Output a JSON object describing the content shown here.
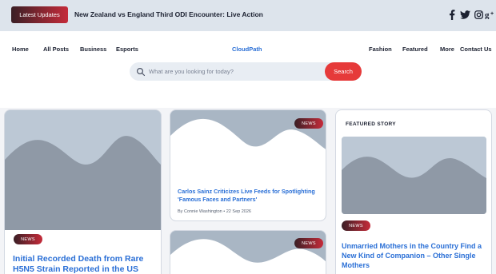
{
  "topbar": {
    "latest_label": "Latest Updates",
    "ticker_text": "New Zealand vs England Third ODI Encounter: Live Action",
    "social_icons": [
      "facebook-icon",
      "twitter-icon",
      "instagram-icon",
      "google-plus-icon"
    ]
  },
  "nav": {
    "items": [
      "Home",
      "All Posts",
      "Business",
      "Esports",
      "Fashion",
      "Featured",
      "More",
      "Contact Us"
    ],
    "logo": "CloudPath"
  },
  "search": {
    "placeholder": "What are you looking for today?",
    "button_label": "Search"
  },
  "posts": [
    {
      "badge": "NEWS",
      "title": "Initial Recorded Death from Rare H5N5 Strain Reported in the US"
    },
    {
      "badge": "NEWS",
      "title": "Carlos Sainz Criticizes Live Feeds for Spotlighting 'Famous Faces and Partners'",
      "author": "By Connie Washington",
      "date": "22 Sep 2026"
    },
    {
      "badge": "NEWS"
    }
  ],
  "featured": {
    "label": "FEATURED STORY",
    "badge": "NEWS",
    "title": "Unmarried Mothers in the Country Find a New Kind of Companion – Other Single Mothers"
  },
  "colors": {
    "accent": "#e63a3a",
    "link": "#2a6fd6",
    "badge_dark": "#3a1f25",
    "placeholder_bg": "#b8c5d3"
  }
}
